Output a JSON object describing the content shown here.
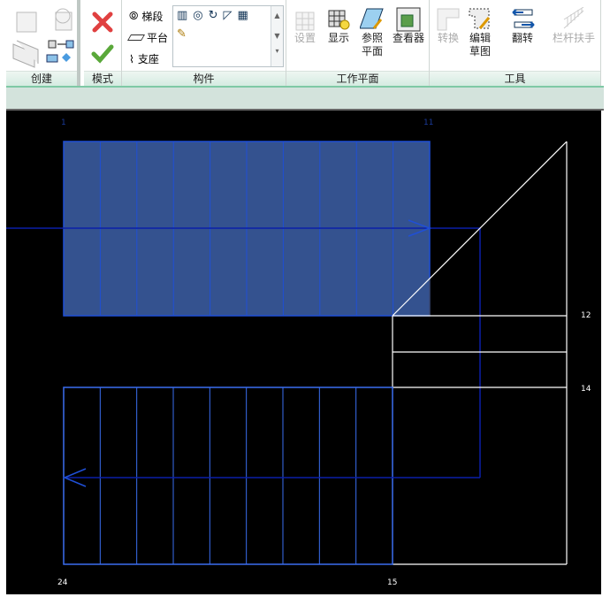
{
  "ribbon": {
    "panels": {
      "create": "创建",
      "mode": "模式",
      "components": "构件",
      "workplane": "工作平面",
      "tools": "工具"
    },
    "components": {
      "run": "梯段",
      "landing": "平台",
      "support": "支座"
    },
    "workplane": {
      "set": "设置",
      "show": "显示",
      "ref_plane_1": "参照",
      "ref_plane_2": "平面",
      "viewer": "查看器"
    },
    "tools": {
      "convert": "转换",
      "edit_sketch_1": "编辑",
      "edit_sketch_2": "草图",
      "flip": "翻转",
      "railing": "栏杆扶手"
    }
  },
  "canvas": {
    "labels": {
      "l1": "1",
      "l11": "11",
      "l12": "12",
      "l14": "14",
      "l24": "24",
      "l15": "15"
    },
    "colors": {
      "run_fill": "#34528f",
      "run_line": "#1f4fd6",
      "path": "#0a1fa8",
      "landing": "#ffffff",
      "background": "#000000"
    }
  }
}
